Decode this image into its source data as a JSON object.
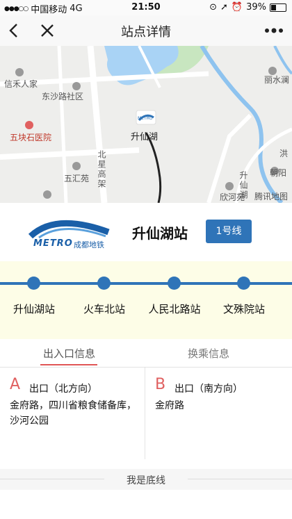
{
  "status_bar": {
    "carrier": "中国移动",
    "network": "4G",
    "time": "21:50",
    "battery": "39%",
    "battery_level": 0.39
  },
  "nav": {
    "title": "站点详情"
  },
  "map": {
    "labels": {
      "xinhe": "信禾人家",
      "dongsha": "东沙路社区",
      "wukuaishi": "五块石医院",
      "shengxianhu": "升仙湖",
      "wuhuiyuan": "五汇苑",
      "beixing": "北星高架",
      "lishui": "丽水澜",
      "hong": "洪",
      "chaoyang": "朝阳",
      "shengxianhu_road": "升仙湖",
      "xinyuan": "欣河苑",
      "tencent": "腾讯地图"
    },
    "station_marker_text": "METRO"
  },
  "station": {
    "name": "升仙湖站",
    "line_badge": "1号线",
    "logo_text": "METRO",
    "logo_cn": "成都地铁"
  },
  "line_stops": [
    "升仙湖站",
    "火车北站",
    "人民北路站",
    "文殊院站"
  ],
  "tabs": {
    "exits": "出入口信息",
    "transfer": "换乘信息"
  },
  "exits": [
    {
      "letter": "A",
      "title": "出口（北方向）",
      "desc": "金府路，四川省粮食储备库，沙河公园"
    },
    {
      "letter": "B",
      "title": "出口（南方向）",
      "desc": "金府路"
    }
  ],
  "footer": {
    "text": "我是底线"
  },
  "colors": {
    "accent": "#2f74b8",
    "tab_underline": "#e05555",
    "exit_letter": "#e06060",
    "strip_bg": "#fdfde7"
  }
}
